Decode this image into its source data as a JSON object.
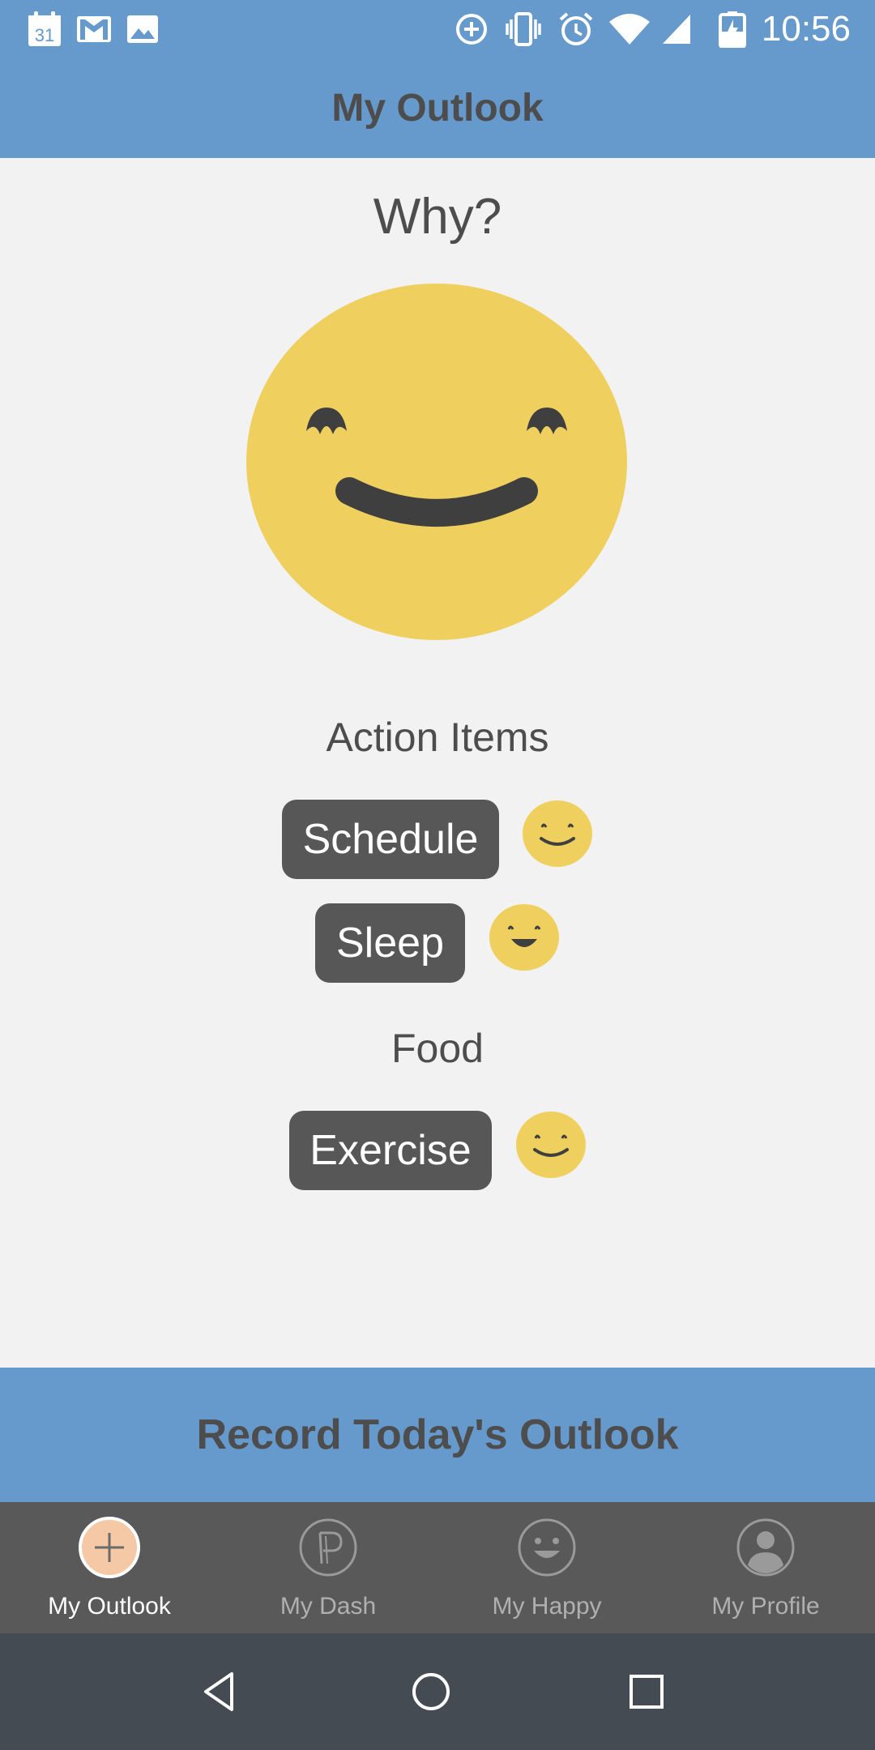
{
  "status_bar": {
    "time": "10:56",
    "calendar_day": "31",
    "left_icons": [
      "calendar-icon",
      "gmail-icon",
      "image-icon"
    ],
    "right_icons": [
      "data-saver-icon",
      "vibrate-icon",
      "alarm-icon",
      "wifi-icon",
      "signal-icon",
      "battery-charging-icon"
    ]
  },
  "header": {
    "title": "My Outlook"
  },
  "main": {
    "question": "Why?",
    "mood_icon": "smile-face-icon",
    "action_items_heading": "Action Items",
    "items": [
      {
        "label": "Schedule",
        "mood_icon": "smile-face-icon"
      },
      {
        "label": "Sleep",
        "mood_icon": "grin-face-icon"
      }
    ],
    "food_heading": "Food",
    "food_items": [
      {
        "label": "Exercise",
        "mood_icon": "smile-face-icon"
      }
    ]
  },
  "record_button": {
    "label": "Record Today's Outlook"
  },
  "tabs": [
    {
      "label": "My Outlook",
      "icon": "plus-icon",
      "active": true
    },
    {
      "label": "My Dash",
      "icon": "dash-p-icon",
      "active": false
    },
    {
      "label": "My Happy",
      "icon": "happy-face-icon",
      "active": false
    },
    {
      "label": "My Profile",
      "icon": "profile-icon",
      "active": false
    }
  ],
  "nav": {
    "icons": [
      "back-icon",
      "home-icon",
      "recents-icon"
    ]
  },
  "colors": {
    "header_bg": "#6699cc",
    "chip_bg": "#575757",
    "emoji_yellow": "#efcf5e",
    "tab_bar_bg": "#595959",
    "nav_bar_bg": "#454b52",
    "active_tab_circle": "#f5c9a6"
  }
}
